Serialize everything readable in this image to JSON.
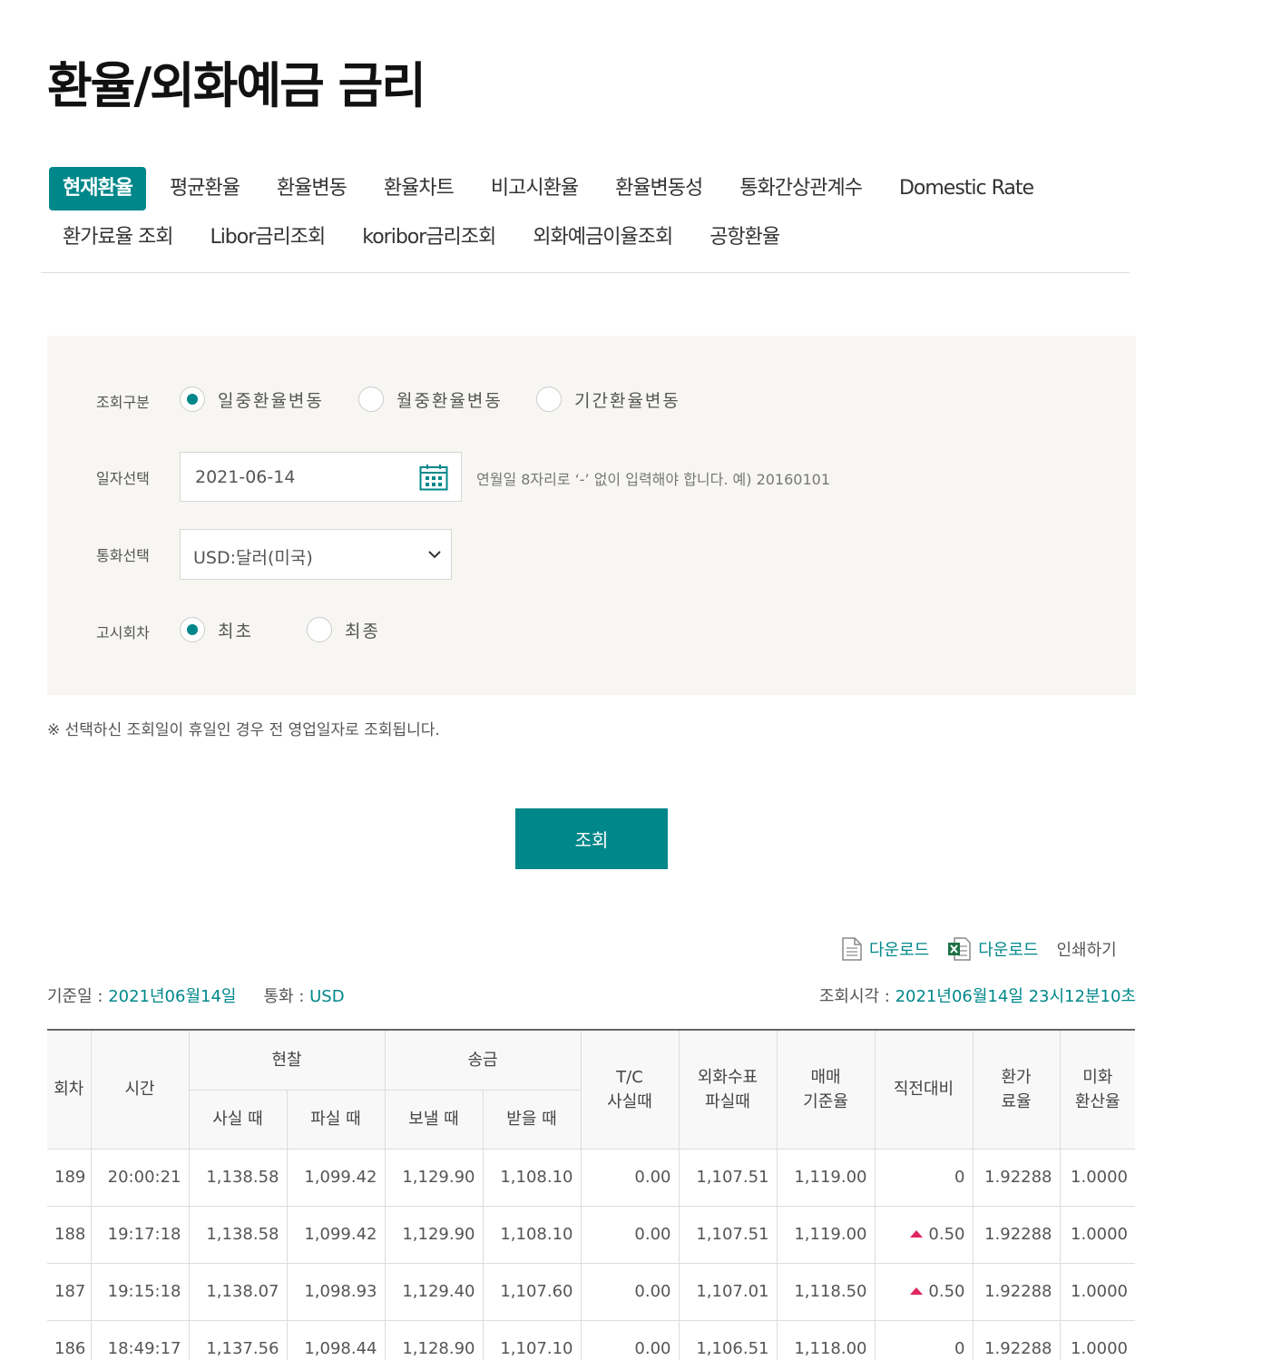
{
  "page": {
    "title": "환율/외화예금 금리"
  },
  "tabs": {
    "row1": [
      "현재환율",
      "평균환율",
      "환율변동",
      "환율차트",
      "비고시환율",
      "환율변동성",
      "통화간상관계수",
      "Domestic Rate"
    ],
    "row2": [
      "환가료율 조회",
      "Libor금리조회",
      "koribor금리조회",
      "외화예금이율조회",
      "공항환율"
    ],
    "active": "현재환율"
  },
  "search": {
    "type_label": "조회구분",
    "type_options": [
      "일중환율변동",
      "월중환율변동",
      "기간환율변동"
    ],
    "type_selected": "일중환율변동",
    "date_label": "일자선택",
    "date_value": "2021-06-14",
    "date_hint": "연월일 8자리로 ‘-’ 없이 입력해야 합니다. 예) 20160101",
    "currency_label": "통화선택",
    "currency_value": "USD:달러(미국)",
    "notice_label": "고시회차",
    "notice_options": [
      "최초",
      "최종"
    ],
    "notice_selected": "최초"
  },
  "notice": "※ 선택하신 조회일이 휴일인 경우 전 영업일자로 조회됩니다.",
  "search_button": "조회",
  "tools": {
    "download_pdf": "다운로드",
    "download_excel": "다운로드",
    "print": "인쇄하기"
  },
  "info": {
    "base_date_label": "기준일 : ",
    "base_date": "2021년06월14일",
    "currency_label": "통화 : ",
    "currency": "USD",
    "query_time_label": "조회시각 : ",
    "query_time": "2021년06월14일 23시12분10초"
  },
  "table": {
    "headers": {
      "round": "회차",
      "time": "시간",
      "cash": "현찰",
      "cash_buy": "사실 때",
      "cash_sell": "파실 때",
      "remit": "송금",
      "remit_send": "보낼 때",
      "remit_receive": "받을 때",
      "tc": "T/C\n사실때",
      "check": "외화수표\n파실때",
      "base": "매매\n기준율",
      "change": "직전대비",
      "fee": "환가\n료율",
      "usd_rate": "미화\n환산율"
    },
    "rows": [
      {
        "round": "189",
        "time": "20:00:21",
        "cash_buy": "1,138.58",
        "cash_sell": "1,099.42",
        "send": "1,129.90",
        "receive": "1,108.10",
        "tc": "0.00",
        "check": "1,107.51",
        "base": "1,119.00",
        "change": "0",
        "change_up": false,
        "fee": "1.92288",
        "usd_rate": "1.0000"
      },
      {
        "round": "188",
        "time": "19:17:18",
        "cash_buy": "1,138.58",
        "cash_sell": "1,099.42",
        "send": "1,129.90",
        "receive": "1,108.10",
        "tc": "0.00",
        "check": "1,107.51",
        "base": "1,119.00",
        "change": "0.50",
        "change_up": true,
        "fee": "1.92288",
        "usd_rate": "1.0000"
      },
      {
        "round": "187",
        "time": "19:15:18",
        "cash_buy": "1,138.07",
        "cash_sell": "1,098.93",
        "send": "1,129.40",
        "receive": "1,107.60",
        "tc": "0.00",
        "check": "1,107.01",
        "base": "1,118.50",
        "change": "0.50",
        "change_up": true,
        "fee": "1.92288",
        "usd_rate": "1.0000"
      },
      {
        "round": "186",
        "time": "18:49:17",
        "cash_buy": "1,137.56",
        "cash_sell": "1,098.44",
        "send": "1,128.90",
        "receive": "1,107.10",
        "tc": "0.00",
        "check": "1,106.51",
        "base": "1,118.00",
        "change": "0",
        "change_up": false,
        "fee": "1.92288",
        "usd_rate": "1.0000"
      }
    ]
  },
  "colors": {
    "accent": "#00878a",
    "up": "#e0245e"
  }
}
